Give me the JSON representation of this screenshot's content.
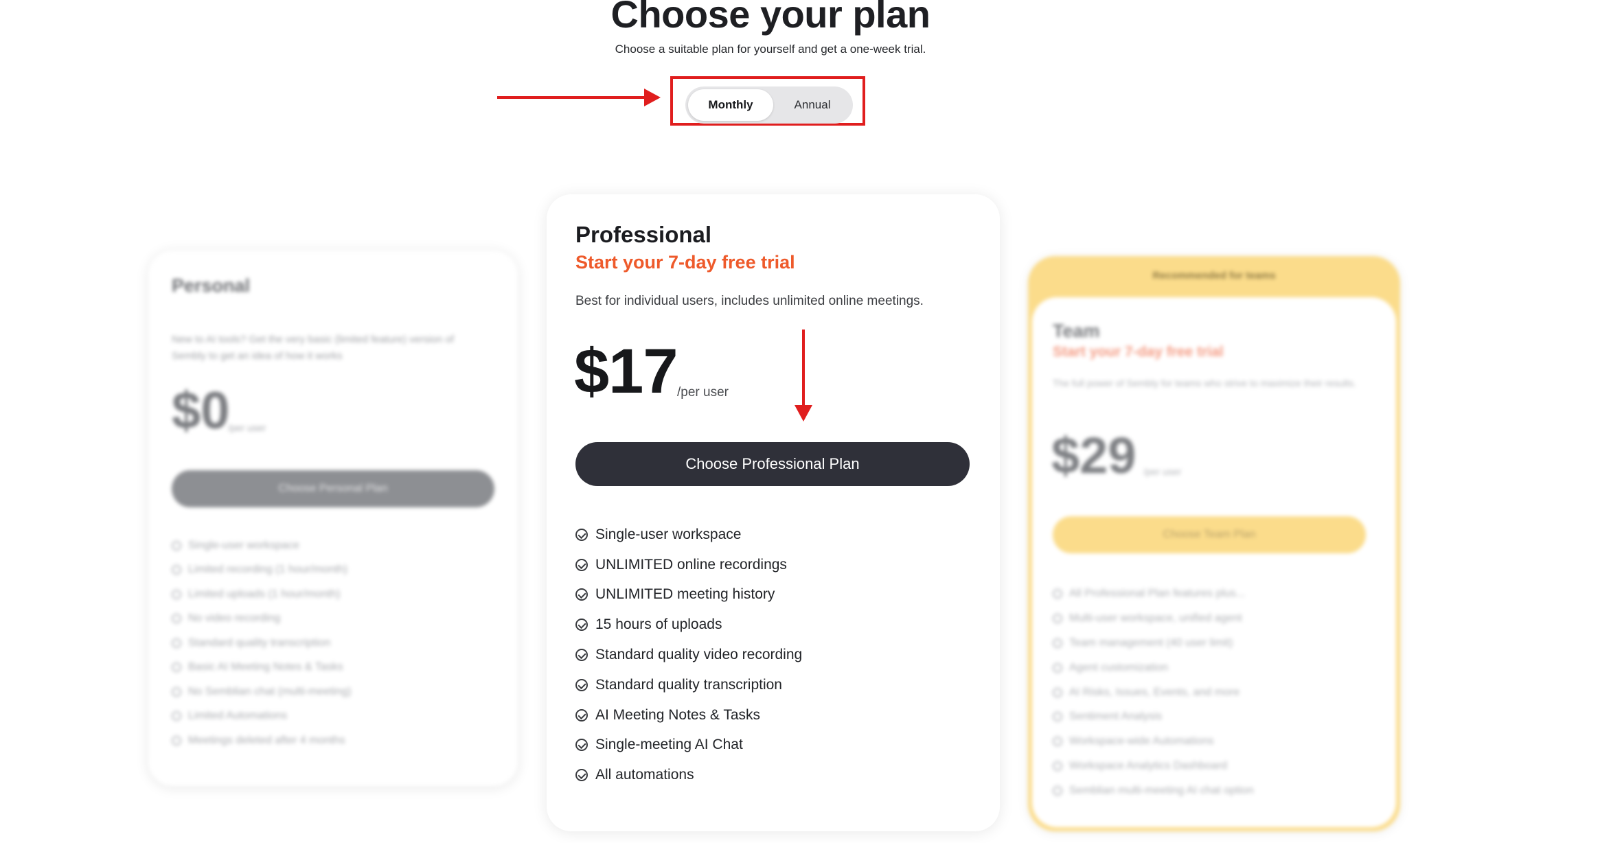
{
  "header": {
    "title": "Choose your plan",
    "subtitle": "Choose a suitable plan for yourself and get a one-week trial."
  },
  "billing_toggle": {
    "options": [
      "Monthly",
      "Annual"
    ],
    "selected": "Monthly"
  },
  "annotation_color": "#e01e1e",
  "plans": {
    "personal": {
      "name": "Personal",
      "description": "New to AI tools? Get the very basic (limited feature) version of Sembly to get an idea of how it works",
      "price": "$0",
      "per": "/per user",
      "cta": "Choose Personal Plan",
      "features": [
        "Single-user workspace",
        "Limited recording (1 hour/month)",
        "Limited uploads (1 hour/month)",
        "No video recording",
        "Standard quality transcription",
        "Basic AI Meeting Notes & Tasks",
        "No Semblian chat (multi-meeting)",
        "Limited Automations",
        "Meetings deleted after 4 months"
      ]
    },
    "professional": {
      "name": "Professional",
      "trial": "Start your 7-day free trial",
      "description": "Best for individual users, includes unlimited online meetings.",
      "price": "$17",
      "per": "/per user",
      "cta": "Choose Professional Plan",
      "features": [
        "Single-user workspace",
        "UNLIMITED online recordings",
        "UNLIMITED meeting history",
        "15 hours of uploads",
        "Standard quality video recording",
        "Standard quality transcription",
        "AI Meeting Notes & Tasks",
        "Single-meeting AI Chat",
        "All automations"
      ]
    },
    "team": {
      "badge": "Recommended for teams",
      "name": "Team",
      "trial": "Start your 7-day free trial",
      "description": "The full power of Sembly for teams who strive to maximize their results.",
      "price": "$29",
      "per": "/per user",
      "cta": "Choose Team Plan",
      "features": [
        "All Professional Plan features plus...",
        "Multi-user workspace, unified agent",
        "Team management (40 user limit)",
        "Agent customization",
        "AI Risks, Issues, Events, and more",
        "Sentiment Analysis",
        "Workspace-wide Automations",
        "Workspace Analytics Dashboard",
        "Semblian multi-meeting AI chat option"
      ]
    }
  }
}
